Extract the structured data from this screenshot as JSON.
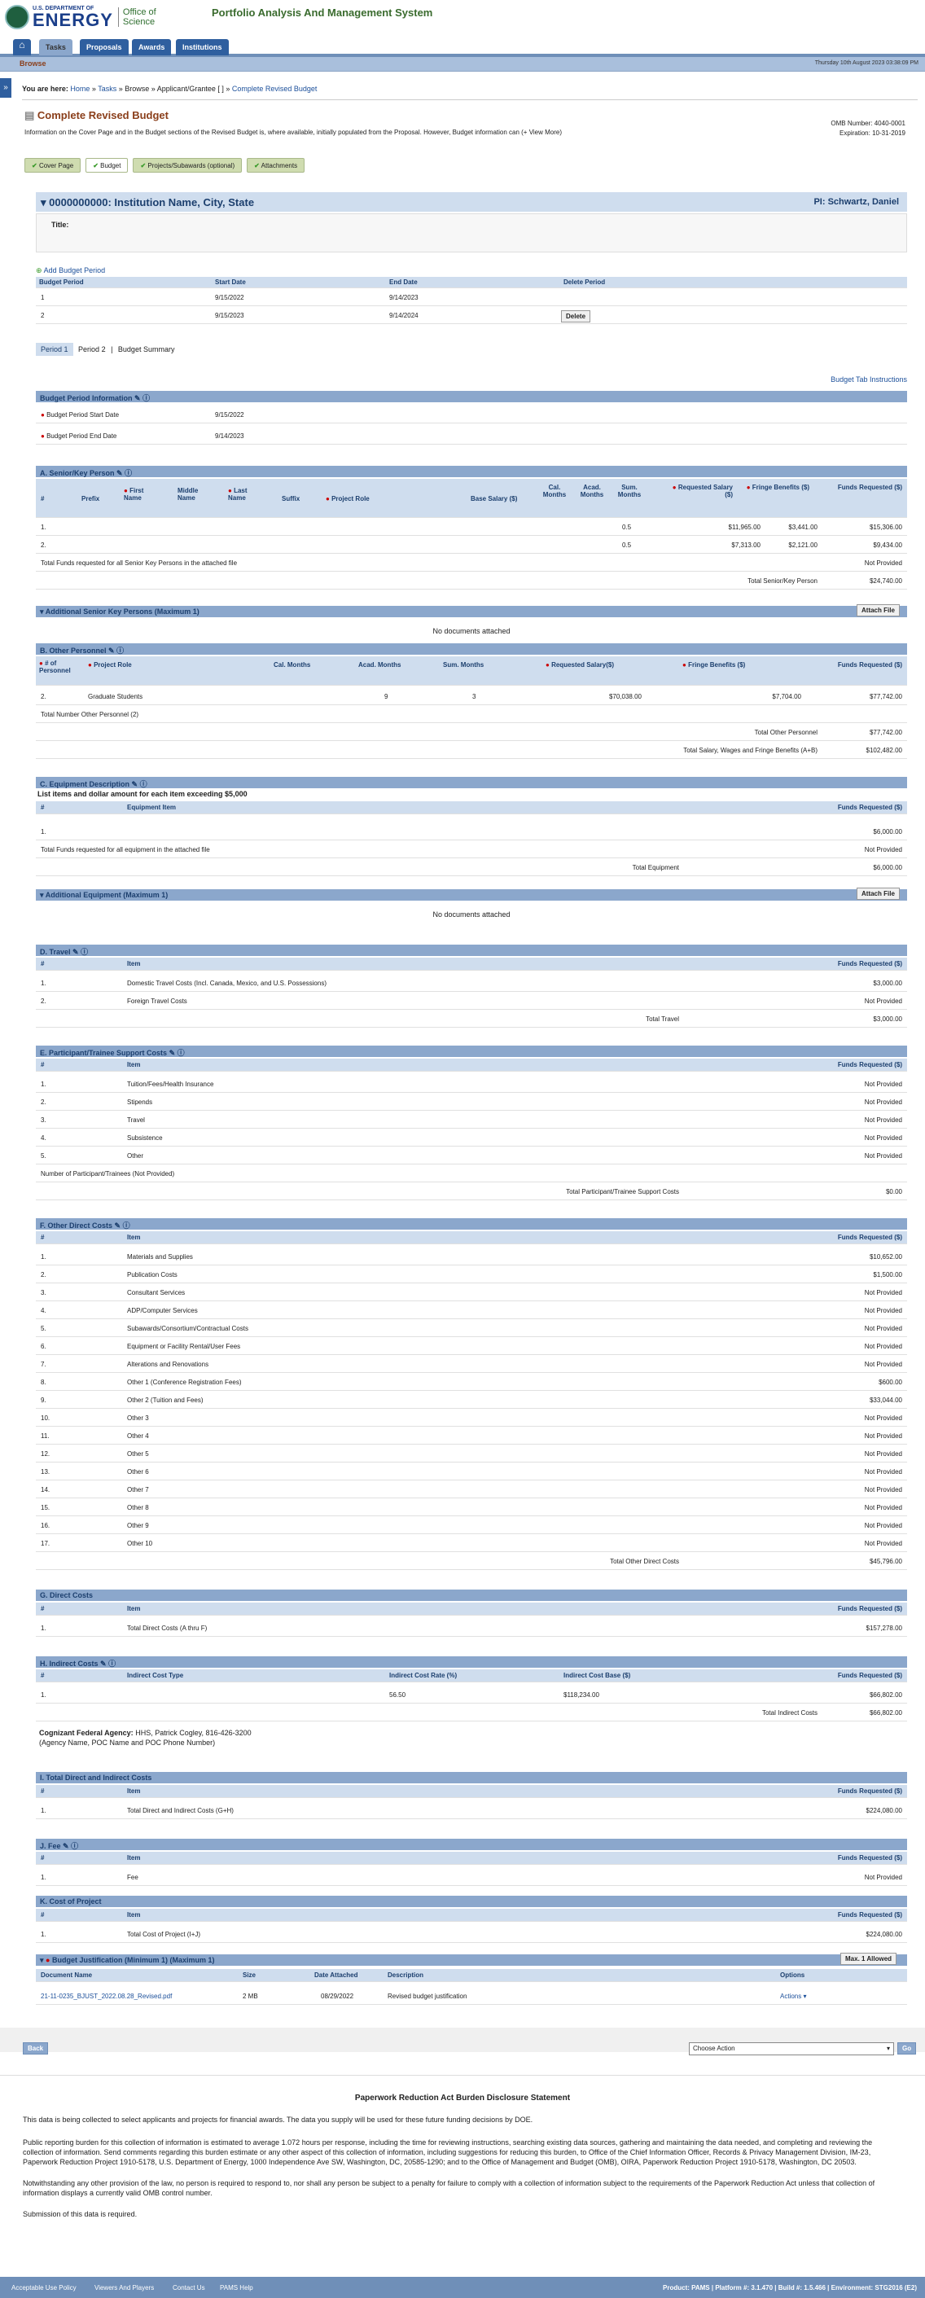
{
  "header": {
    "logo_l1": "U.S. DEPARTMENT OF",
    "logo_l2": "ENERGY",
    "logo_office": "Office of Science",
    "app_title": "Portfolio Analysis And Management System"
  },
  "nav": {
    "tabs": [
      "Tasks",
      "Proposals",
      "Awards",
      "Institutions"
    ],
    "browse": "Browse",
    "date": "Thursday 10th August 2023 03:38:09 PM"
  },
  "breadcrumb": {
    "prefix": "You are here:",
    "items": [
      "Home",
      "Tasks",
      "Browse",
      "Applicant/Grantee [ ]",
      "Complete Revised Budget"
    ]
  },
  "page": {
    "title": "Complete Revised Budget",
    "omb_number": "OMB Number: 4040-0001",
    "expiration": "Expiration: 10-31-2019",
    "info": "Information on the Cover Page and in the Budget sections of the Revised Budget is, where available, initially populated from the Proposal. However, Budget information can (+ View More)"
  },
  "steps": [
    "Cover Page",
    "Budget",
    "Projects/Subawards (optional)",
    "Attachments"
  ],
  "proposal": {
    "title": "0000000000:  Institution Name, City, State",
    "pi": "PI: Schwartz, Daniel",
    "title_label": "Title:"
  },
  "periods": {
    "add": "Add Budget Period",
    "cols": [
      "Budget Period",
      "Start Date",
      "End Date",
      "Delete Period"
    ],
    "rows": [
      [
        "1",
        "9/15/2022",
        "9/14/2023",
        ""
      ],
      [
        "2",
        "9/15/2023",
        "9/14/2024",
        "Delete"
      ]
    ]
  },
  "period_tabs": [
    "Period 1",
    "Period 2",
    "Budget Summary"
  ],
  "instructions": "Budget Tab Instructions",
  "bpi": {
    "title": "Budget Period Information",
    "start_label": "Budget Period Start Date",
    "start": "9/15/2022",
    "end_label": "Budget Period End Date",
    "end": "9/14/2023"
  },
  "senior": {
    "title": "A. Senior/Key Person",
    "cols": [
      "#",
      "Prefix",
      "First Name",
      "Middle Name",
      "Last Name",
      "Suffix",
      "Project Role",
      "Base Salary ($)",
      "Cal. Months",
      "Acad. Months",
      "Sum. Months",
      "Requested Salary ($)",
      "Fringe Benefits ($)",
      "Funds Requested ($)"
    ],
    "rows": [
      [
        "1.",
        "0.5",
        "$11,965.00",
        "$3,441.00",
        "$15,306.00"
      ],
      [
        "2.",
        "0.5",
        "$7,313.00",
        "$2,121.00",
        "$9,434.00"
      ]
    ],
    "attached_label": "Total Funds requested for all Senior Key Persons in the attached file",
    "attached_val": "Not Provided",
    "total_label": "Total Senior/Key Person",
    "total": "$24,740.00"
  },
  "add_senior": {
    "title": "Additional Senior Key Persons (Maximum 1)",
    "btn": "Attach File",
    "empty": "No documents attached"
  },
  "other": {
    "title": "B. Other Personnel",
    "cols": [
      "# of Personnel",
      "Project Role",
      "Cal. Months",
      "Acad. Months",
      "Sum. Months",
      "Requested Salary($)",
      "Fringe Benefits ($)",
      "Funds Requested ($)"
    ],
    "row": [
      "2.",
      "Graduate Students",
      "",
      "9",
      "3",
      "$70,038.00",
      "$7,704.00",
      "$77,742.00"
    ],
    "count": "Total Number Other Personnel (2)",
    "total_label": "Total Other Personnel",
    "total": "$77,742.00",
    "sw_label": "Total Salary, Wages and Fringe Benefits (A+B)",
    "sw": "$102,482.00"
  },
  "equip": {
    "title": "C. Equipment Description",
    "note": "List items and dollar amount for each item exceeding $5,000",
    "cols": [
      "#",
      "Equipment Item",
      "Funds Requested ($)"
    ],
    "row": [
      "1.",
      "",
      "$6,000.00"
    ],
    "attached_label": "Total Funds requested for all equipment in the attached file",
    "attached_val": "Not Provided",
    "total_label": "Total Equipment",
    "total": "$6,000.00"
  },
  "add_equip": {
    "title": "Additional Equipment (Maximum 1)",
    "btn": "Attach File",
    "empty": "No documents attached"
  },
  "travel": {
    "title": "D. Travel",
    "cols": [
      "#",
      "Item",
      "Funds Requested ($)"
    ],
    "rows": [
      [
        "1.",
        "Domestic Travel Costs (Incl. Canada, Mexico, and U.S. Possessions)",
        "$3,000.00"
      ],
      [
        "2.",
        "Foreign Travel Costs",
        "Not Provided"
      ]
    ],
    "total_label": "Total Travel",
    "total": "$3,000.00"
  },
  "participant": {
    "title": "E. Participant/Trainee Support Costs",
    "cols": [
      "#",
      "Item",
      "Funds Requested ($)"
    ],
    "rows": [
      [
        "1.",
        "Tuition/Fees/Health Insurance",
        "Not Provided"
      ],
      [
        "2.",
        "Stipends",
        "Not Provided"
      ],
      [
        "3.",
        "Travel",
        "Not Provided"
      ],
      [
        "4.",
        "Subsistence",
        "Not Provided"
      ],
      [
        "5.",
        "Other",
        "Not Provided"
      ]
    ],
    "count": "Number of Participant/Trainees (Not Provided)",
    "total_label": "Total Participant/Trainee Support Costs",
    "total": "$0.00"
  },
  "odc": {
    "title": "F. Other Direct Costs",
    "cols": [
      "#",
      "Item",
      "Funds Requested ($)"
    ],
    "rows": [
      [
        "1.",
        "Materials and Supplies",
        "$10,652.00"
      ],
      [
        "2.",
        "Publication Costs",
        "$1,500.00"
      ],
      [
        "3.",
        "Consultant Services",
        "Not Provided"
      ],
      [
        "4.",
        "ADP/Computer Services",
        "Not Provided"
      ],
      [
        "5.",
        "Subawards/Consortium/Contractual Costs",
        "Not Provided"
      ],
      [
        "6.",
        "Equipment or Facility Rental/User Fees",
        "Not Provided"
      ],
      [
        "7.",
        "Alterations and Renovations",
        "Not Provided"
      ],
      [
        "8.",
        "Other 1  (Conference Registration Fees)",
        "$600.00"
      ],
      [
        "9.",
        "Other 2  (Tuition and Fees)",
        "$33,044.00"
      ],
      [
        "10.",
        "Other 3",
        "Not Provided"
      ],
      [
        "11.",
        "Other 4",
        "Not Provided"
      ],
      [
        "12.",
        "Other 5",
        "Not Provided"
      ],
      [
        "13.",
        "Other 6",
        "Not Provided"
      ],
      [
        "14.",
        "Other 7",
        "Not Provided"
      ],
      [
        "15.",
        "Other 8",
        "Not Provided"
      ],
      [
        "16.",
        "Other 9",
        "Not Provided"
      ],
      [
        "17.",
        "Other 10",
        "Not Provided"
      ]
    ],
    "total_label": "Total Other Direct Costs",
    "total": "$45,796.00"
  },
  "direct": {
    "title": "G. Direct Costs",
    "cols": [
      "#",
      "Item",
      "Funds Requested ($)"
    ],
    "row": [
      "1.",
      "Total Direct Costs (A thru F)",
      "$157,278.00"
    ]
  },
  "indirect": {
    "title": "H. Indirect Costs",
    "cols": [
      "#",
      "Indirect Cost Type",
      "Indirect Cost Rate (%)",
      "Indirect Cost Base ($)",
      "Funds Requested ($)"
    ],
    "row": [
      "1.",
      "",
      "56.50",
      "$118,234.00",
      "$66,802.00"
    ],
    "total_label": "Total Indirect Costs",
    "total": "$66,802.00",
    "agency": "Cognizant Federal Agency:",
    "agency_val": "HHS, Patrick Cogley, 816-426-3200",
    "agency_note": "(Agency Name, POC Name and POC Phone Number)"
  },
  "total_di": {
    "title": "I. Total Direct and Indirect Costs",
    "cols": [
      "#",
      "Item",
      "Funds Requested ($)"
    ],
    "row": [
      "1.",
      "Total Direct and Indirect Costs (G+H)",
      "$224,080.00"
    ]
  },
  "fee": {
    "title": "J. Fee",
    "cols": [
      "#",
      "Item",
      "Funds Requested ($)"
    ],
    "row": [
      "1.",
      "Fee",
      "Not Provided"
    ]
  },
  "cost": {
    "title": "K. Cost of Project",
    "cols": [
      "#",
      "Item",
      "Funds Requested ($)"
    ],
    "row": [
      "1.",
      "Total Cost of Project (I+J)",
      "$224,080.00"
    ]
  },
  "justification": {
    "title": "Budget Justification (Minimum 1) (Maximum 1)",
    "btn": "Max. 1 Allowed",
    "cols": [
      "Document Name",
      "Size",
      "Date Attached",
      "Description",
      "Options"
    ],
    "row": [
      "21-11-0235_BJUST_2022.08.28_Revised.pdf",
      "2 MB",
      "08/29/2022",
      "Revised budget justification",
      "Actions"
    ]
  },
  "actions": {
    "back": "Back",
    "select": "Choose Action",
    "go": "Go"
  },
  "prab": {
    "title": "Paperwork Reduction Act Burden Disclosure Statement",
    "p1": "This data is being collected to select applicants and projects for financial awards. The data you supply will be used for these future funding decisions by DOE.",
    "p2": "Public reporting burden for this collection of information is estimated to average 1.072 hours per response, including the time for reviewing instructions, searching existing data sources, gathering and maintaining the data needed, and completing and reviewing the collection of information. Send comments regarding this burden estimate or any other aspect of this collection of information, including suggestions for reducing this burden, to Office of the Chief Information Officer, Records & Privacy Management Division, IM-23, Paperwork Reduction Project 1910-5178, U.S. Department of Energy, 1000 Independence Ave SW, Washington, DC, 20585-1290; and to the Office of Management and Budget (OMB), OIRA, Paperwork Reduction Project 1910-5178, Washington, DC 20503.",
    "p3": "Notwithstanding any other provision of the law, no person is required to respond to, nor shall any person be subject to a penalty for failure to comply with a collection of information subject to the requirements of the Paperwork Reduction Act unless that collection of information displays a currently valid OMB control number.",
    "p4": "Submission of this data is required."
  },
  "footer": {
    "links": [
      "Acceptable Use Policy",
      "Viewers And Players",
      "Contact Us",
      "PAMS Help"
    ],
    "meta": "Product: PAMS  |  Platform #: 3.1.470  |  Build #: 1.5.466  |  Environment: STG2016 (E2)"
  }
}
